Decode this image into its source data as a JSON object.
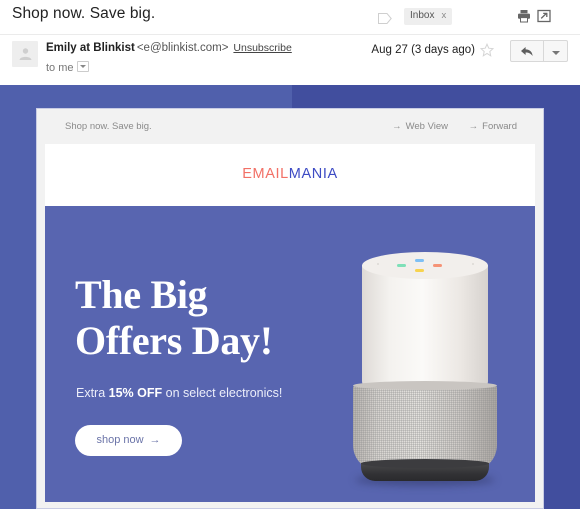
{
  "mail": {
    "subject": "Shop now. Save big.",
    "label_chip": "Inbox",
    "label_chip_close": "x",
    "icons": {
      "label_tag": "label-tag-icon",
      "print": "printer-icon",
      "popout": "open-in-new-window-icon",
      "avatar": "avatar-placeholder-icon",
      "star": "star-icon",
      "reply": "reply-icon"
    },
    "sender_name": "Emily at Blinkist",
    "sender_address": "<e@blinkist.com>",
    "unsubscribe": "Unsubscribe",
    "recipient": "to me",
    "date": "Aug 27 (3 days ago)"
  },
  "email": {
    "preheader": {
      "text": "Shop now. Save big.",
      "web_view": "Web View",
      "forward": "Forward",
      "arrow": "→"
    },
    "logo": {
      "part_one": "EMAIL",
      "part_two": "MANIA",
      "color_one": "#F27066",
      "color_two": "#3D4BC4"
    },
    "hero": {
      "headline": "The Big\nOffers Day!",
      "sub_before": "Extra ",
      "sub_bold": "15% OFF",
      "sub_after": " on select electronics!",
      "cta_label": "shop now",
      "cta_arrow": "→",
      "background_color": "#5865B0",
      "product": "google-home-smart-speaker",
      "led_colors": [
        "#7ee0b8",
        "#7ec0f5",
        "#f7d34f",
        "#f59376"
      ]
    }
  },
  "page": {
    "backdrop_color_left": "#5060AC",
    "backdrop_color_right": "#414E9E"
  }
}
